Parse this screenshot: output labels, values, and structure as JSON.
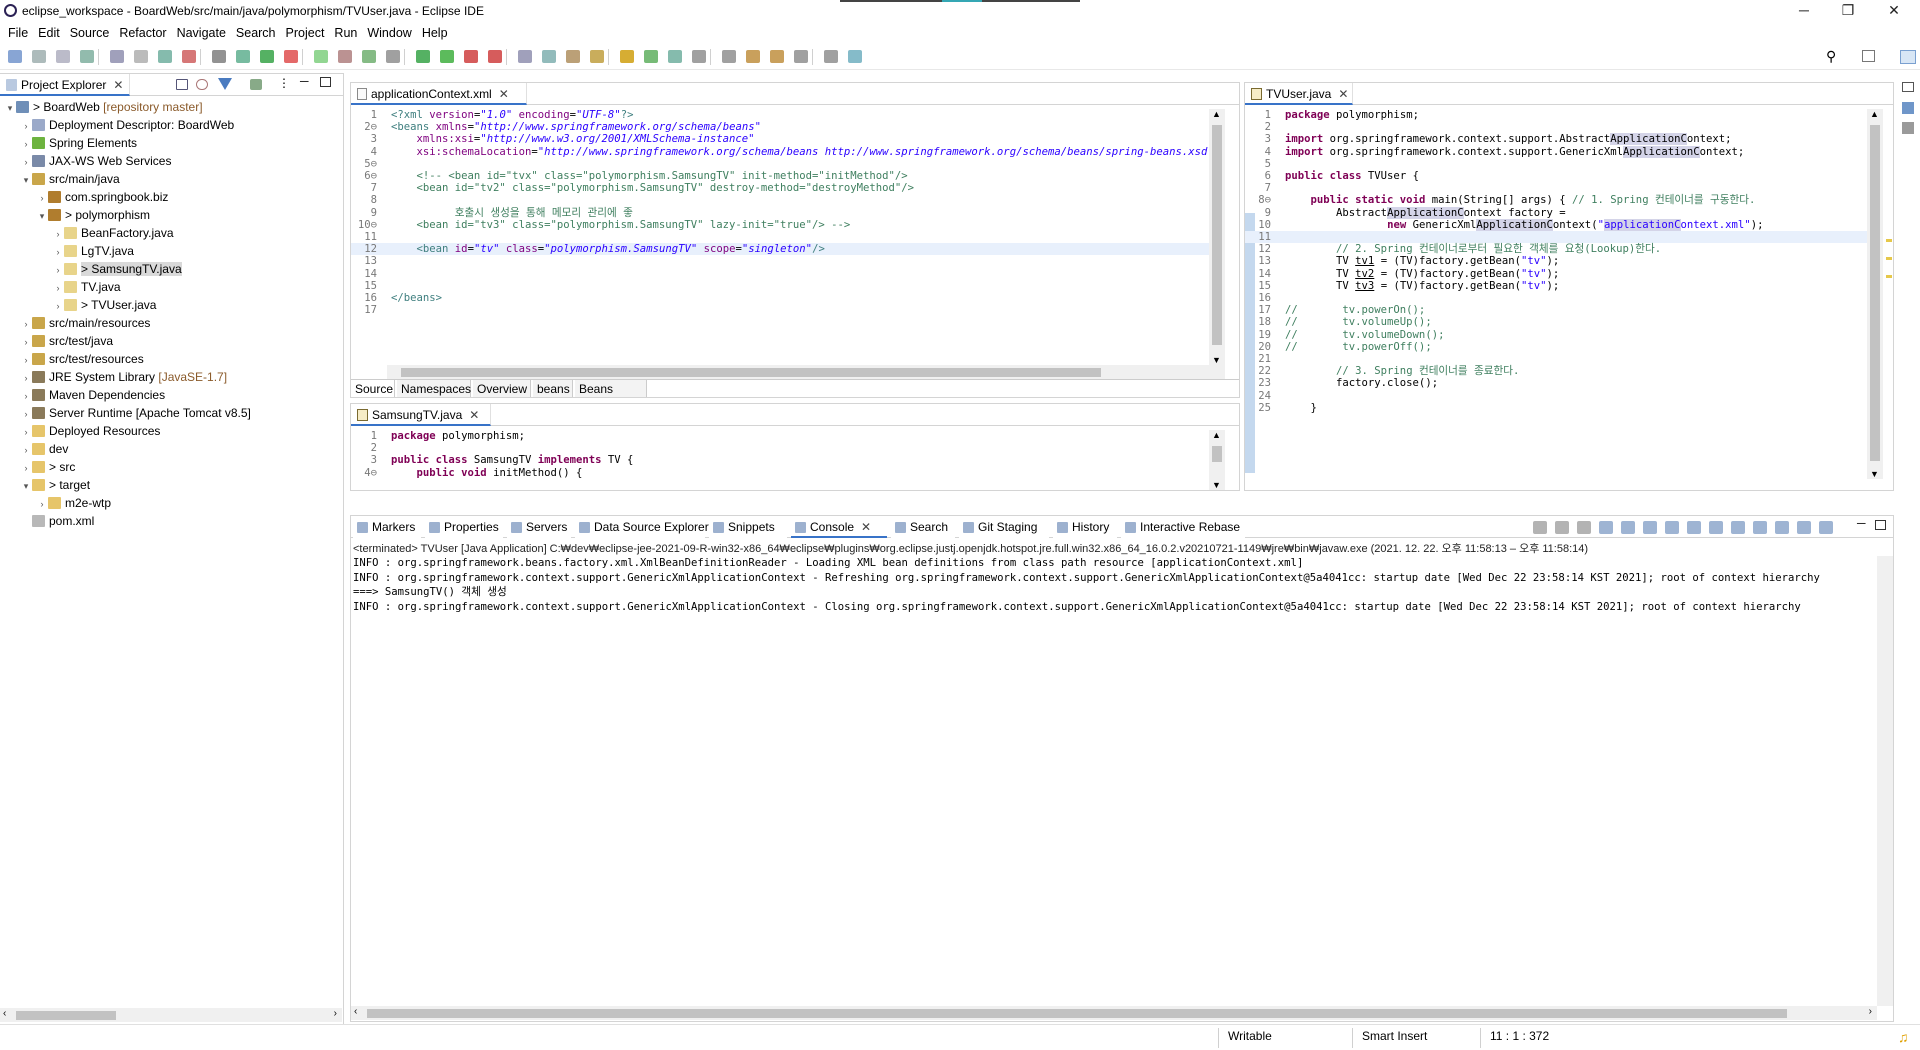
{
  "window": {
    "title": "eclipse_workspace - BoardWeb/src/main/java/polymorphism/TVUser.java - Eclipse IDE",
    "minimize": "─",
    "maximize": "❐",
    "close": "✕"
  },
  "menu": [
    "File",
    "Edit",
    "Source",
    "Refactor",
    "Navigate",
    "Search",
    "Project",
    "Run",
    "Window",
    "Help"
  ],
  "explorer": {
    "title": "Project Explorer",
    "items": [
      {
        "indent": 0,
        "twisty": "▾",
        "label": "> BoardWeb",
        "extra": " [repository master]",
        "icon": "project-icon",
        "color": "#6f8fb8"
      },
      {
        "indent": 1,
        "twisty": "›",
        "label": "Deployment Descriptor: BoardWeb",
        "extra": "",
        "icon": "descriptor-icon",
        "color": "#9aa9c9"
      },
      {
        "indent": 1,
        "twisty": "›",
        "label": "Spring Elements",
        "extra": "",
        "icon": "spring-icon",
        "color": "#6db33f"
      },
      {
        "indent": 1,
        "twisty": "›",
        "label": "JAX-WS Web Services",
        "extra": "",
        "icon": "webservice-icon",
        "color": "#7a8aa8"
      },
      {
        "indent": 1,
        "twisty": "▾",
        "label": "src/main/java",
        "extra": "",
        "icon": "source-folder-icon",
        "color": "#c9a64a"
      },
      {
        "indent": 2,
        "twisty": "›",
        "label": "com.springbook.biz",
        "extra": "",
        "icon": "package-icon",
        "color": "#b07d2e"
      },
      {
        "indent": 2,
        "twisty": "▾",
        "label": "> polymorphism",
        "extra": "",
        "icon": "package-icon",
        "color": "#b07d2e"
      },
      {
        "indent": 3,
        "twisty": "›",
        "label": "BeanFactory.java",
        "extra": "",
        "icon": "java-file-icon",
        "color": "#e8d48a"
      },
      {
        "indent": 3,
        "twisty": "›",
        "label": "LgTV.java",
        "extra": "",
        "icon": "java-file-icon",
        "color": "#e8d48a"
      },
      {
        "indent": 3,
        "twisty": "›",
        "label": "> SamsungTV.java",
        "extra": "",
        "icon": "java-file-icon",
        "color": "#e8d48a",
        "selected": true
      },
      {
        "indent": 3,
        "twisty": "›",
        "label": "TV.java",
        "extra": "",
        "icon": "java-file-icon",
        "color": "#e8d48a"
      },
      {
        "indent": 3,
        "twisty": "›",
        "label": "> TVUser.java",
        "extra": "",
        "icon": "java-file-icon",
        "color": "#e8d48a"
      },
      {
        "indent": 1,
        "twisty": "›",
        "label": "src/main/resources",
        "extra": "",
        "icon": "source-folder-icon",
        "color": "#c9a64a"
      },
      {
        "indent": 1,
        "twisty": "›",
        "label": "src/test/java",
        "extra": "",
        "icon": "source-folder-icon",
        "color": "#c9a64a"
      },
      {
        "indent": 1,
        "twisty": "›",
        "label": "src/test/resources",
        "extra": "",
        "icon": "source-folder-icon",
        "color": "#c9a64a"
      },
      {
        "indent": 1,
        "twisty": "›",
        "label": "JRE System Library",
        "extra": " [JavaSE-1.7]",
        "icon": "library-icon",
        "color": "#8a7a5a"
      },
      {
        "indent": 1,
        "twisty": "›",
        "label": "Maven Dependencies",
        "extra": "",
        "icon": "library-icon",
        "color": "#8a7a5a"
      },
      {
        "indent": 1,
        "twisty": "›",
        "label": "Server Runtime [Apache Tomcat v8.5]",
        "extra": "",
        "icon": "library-icon",
        "color": "#8a7a5a"
      },
      {
        "indent": 1,
        "twisty": "›",
        "label": "Deployed Resources",
        "extra": "",
        "icon": "folder-icon",
        "color": "#e6c56a"
      },
      {
        "indent": 1,
        "twisty": "›",
        "label": "dev",
        "extra": "",
        "icon": "folder-icon",
        "color": "#e6c56a"
      },
      {
        "indent": 1,
        "twisty": "›",
        "label": "> src",
        "extra": "",
        "icon": "folder-icon",
        "color": "#e6c56a"
      },
      {
        "indent": 1,
        "twisty": "▾",
        "label": "> target",
        "extra": "",
        "icon": "folder-icon",
        "color": "#e6c56a"
      },
      {
        "indent": 2,
        "twisty": "›",
        "label": "m2e-wtp",
        "extra": "",
        "icon": "folder-icon",
        "color": "#e6c56a"
      },
      {
        "indent": 1,
        "twisty": "",
        "label": "pom.xml",
        "extra": "",
        "icon": "xml-file-icon",
        "color": "#b8b8b8"
      }
    ]
  },
  "editor_xml": {
    "tab": "applicationContext.xml",
    "subtabs": [
      "Source",
      "Namespaces",
      "Overview",
      "beans",
      "Beans Graph"
    ],
    "lines": [
      {
        "n": "1",
        "html": "<span class='tag'>&lt;?xml</span> <span class='attr'>version</span>=<span class='str'><i>\"1.0\"</i></span> <span class='attr'>encoding</span>=<span class='str'><i>\"UTF-8\"</i></span><span class='tag'>?&gt;</span>"
      },
      {
        "n": "2⊖",
        "html": "<span class='tag'>&lt;beans</span> <span class='attr'>xmlns</span>=<span class='str'><i>\"http://www.springframework.org/schema/beans\"</i></span>"
      },
      {
        "n": "3",
        "html": "    <span class='attr'>xmlns:xsi</span>=<span class='str'><i>\"http://www.w3.org/2001/XMLSchema-instance\"</i></span>"
      },
      {
        "n": "4",
        "html": "    <span class='attr'>xsi:schemaLocation</span>=<span class='str'><i>\"http://www.springframework.org/schema/beans http://www.springframework.org/schema/beans/spring-beans.xsd\"</i></span>"
      },
      {
        "n": "5⊖",
        "html": ""
      },
      {
        "n": "6⊖",
        "html": "    <span class='cm'>&lt;!-- &lt;bean id=\"tvx\" class=\"polymorphism.SamsungTV\" init-method=\"initMethod\"/&gt;</span>"
      },
      {
        "n": "7",
        "html": "    <span class='cm'>&lt;bean id=\"tv2\" class=\"polymorphism.SamsungTV\" destroy-method=\"destroyMethod\"/&gt;</span>"
      },
      {
        "n": "8",
        "html": ""
      },
      {
        "n": "9",
        "html": "          <span class='cm'>호출시 생성을 통해 메모리 관리에 좋</span>"
      },
      {
        "n": "10⊖",
        "html": "    <span class='cm'>&lt;bean id=\"tv3\" class=\"polymorphism.SamsungTV\" lazy-init=\"true\"/&gt; --&gt;</span>"
      },
      {
        "n": "11",
        "html": ""
      },
      {
        "n": "12",
        "html": "    <span class='tag'>&lt;bean</span> <span class='attr'>id</span>=<span class='str'><i>\"tv\"</i></span> <span class='attr'>class</span>=<span class='str'><i>\"polymorphism.SamsungTV\"</i></span> <span class='attr'>scope</span>=<span class='str'><i>\"singleton\"</i></span><span class='tag'>/&gt;</span>",
        "current": true
      },
      {
        "n": "13",
        "html": ""
      },
      {
        "n": "14",
        "html": ""
      },
      {
        "n": "15",
        "html": ""
      },
      {
        "n": "16",
        "html": "<span class='tag'>&lt;/beans&gt;</span>"
      },
      {
        "n": "17",
        "html": ""
      }
    ]
  },
  "editor_samsung": {
    "tab": "SamsungTV.java",
    "lines": [
      {
        "n": "1",
        "html": "<span class='kw'>package</span> polymorphism;"
      },
      {
        "n": "2",
        "html": ""
      },
      {
        "n": "3",
        "html": "<span class='kw'>public class</span> SamsungTV <span class='kw'>implements</span> TV {"
      },
      {
        "n": "4⊖",
        "html": "    <span class='kw'>public void</span> initMethod() {"
      }
    ]
  },
  "editor_tvuser": {
    "tab": "TVUser.java",
    "lines": [
      {
        "n": "1",
        "html": "<span class='kw'>package</span> polymorphism;"
      },
      {
        "n": "2",
        "html": ""
      },
      {
        "n": "3",
        "html": "<span class='kw'>import</span> org.springframework.context.support.Abstract<span class='hl'>ApplicationC</span>ontext;"
      },
      {
        "n": "4",
        "html": "<span class='kw'>import</span> org.springframework.context.support.GenericXml<span class='hl'>ApplicationC</span>ontext;"
      },
      {
        "n": "5",
        "html": ""
      },
      {
        "n": "6",
        "html": "<span class='kw'>public class</span> TVUser {"
      },
      {
        "n": "7",
        "html": ""
      },
      {
        "n": "8⊖",
        "html": "    <span class='kw'>public static void</span> main(String[] args) { <span class='cm'>// 1. Spring 컨테이너를 구동한다.</span>"
      },
      {
        "n": "9",
        "html": "        Abstract<span class='hl'>ApplicationC</span>ontext factory ="
      },
      {
        "n": "10",
        "html": "                <span class='kw'>new</span> GenericXml<span class='hl'>ApplicationC</span>ontext(<span class='str'>\"<span class='hl'>applicationC</span>ontext.xml\"</span>);"
      },
      {
        "n": "11",
        "html": "",
        "current": true
      },
      {
        "n": "12",
        "html": "        <span class='cm'>// 2. Spring 컨테이너로부터 필요한 객체를 요청(Lookup)한다.</span>"
      },
      {
        "n": "13",
        "html": "        TV <u>tv1</u> = (TV)factory.getBean(<span class='str'>\"tv\"</span>);"
      },
      {
        "n": "14",
        "html": "        TV <u>tv2</u> = (TV)factory.getBean(<span class='str'>\"tv\"</span>);"
      },
      {
        "n": "15",
        "html": "        TV <u>tv3</u> = (TV)factory.getBean(<span class='str'>\"tv\"</span>);"
      },
      {
        "n": "16",
        "html": ""
      },
      {
        "n": "17",
        "html": "<span class='cm'>//       tv.powerOn();</span>"
      },
      {
        "n": "18",
        "html": "<span class='cm'>//       tv.volumeUp();</span>"
      },
      {
        "n": "19",
        "html": "<span class='cm'>//       tv.volumeDown();</span>"
      },
      {
        "n": "20",
        "html": "<span class='cm'>//       tv.powerOff();</span>"
      },
      {
        "n": "21",
        "html": ""
      },
      {
        "n": "22",
        "html": "        <span class='cm'>// 3. Spring 컨테이너를 종료한다.</span>"
      },
      {
        "n": "23",
        "html": "        factory.close();"
      },
      {
        "n": "24",
        "html": ""
      },
      {
        "n": "25",
        "html": "    }"
      }
    ]
  },
  "console": {
    "tabs": [
      "Markers",
      "Properties",
      "Servers",
      "Data Source Explorer",
      "Snippets",
      "Console",
      "Search",
      "Git Staging",
      "History",
      "Interactive Rebase"
    ],
    "active_tab": "Console",
    "terminated": "<terminated> TVUser [Java Application] C:₩dev₩eclipse-jee-2021-09-R-win32-x86_64₩eclipse₩plugins₩org.eclipse.justj.openjdk.hotspot.jre.full.win32.x86_64_16.0.2.v20210721-1149₩jre₩bin₩javaw.exe  (2021. 12. 22. 오후 11:58:13 – 오후 11:58:14)",
    "lines": [
      "INFO : org.springframework.beans.factory.xml.XmlBeanDefinitionReader - Loading XML bean definitions from class path resource [applicationContext.xml]",
      "INFO : org.springframework.context.support.GenericXmlApplicationContext - Refreshing org.springframework.context.support.GenericXmlApplicationContext@5a4041cc: startup date [Wed Dec 22 23:58:14 KST 2021]; root of context hierarchy",
      "===> SamsungTV() 객체 생성",
      "INFO : org.springframework.context.support.GenericXmlApplicationContext - Closing org.springframework.context.support.GenericXmlApplicationContext@5a4041cc: startup date [Wed Dec 22 23:58:14 KST 2021]; root of context hierarchy"
    ]
  },
  "status": {
    "writable": "Writable",
    "insert_mode": "Smart Insert",
    "position": "11 : 1 : 372"
  }
}
